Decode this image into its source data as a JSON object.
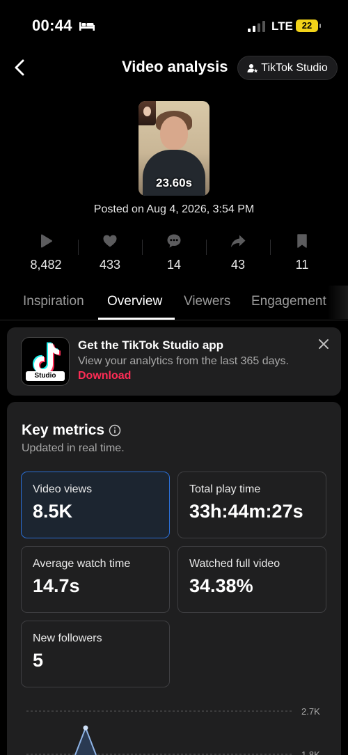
{
  "status_bar": {
    "time": "00:44",
    "network": "LTE",
    "battery": "22"
  },
  "header": {
    "title": "Video analysis",
    "studio_button": "TikTok Studio"
  },
  "video": {
    "duration": "23.60s",
    "posted": "Posted on Aug 4, 2026, 3:54 PM"
  },
  "stats": [
    {
      "icon": "play-icon",
      "value": "8,482"
    },
    {
      "icon": "heart-icon",
      "value": "433"
    },
    {
      "icon": "comment-icon",
      "value": "14"
    },
    {
      "icon": "share-icon",
      "value": "43"
    },
    {
      "icon": "bookmark-icon",
      "value": "11"
    }
  ],
  "tabs": [
    "Inspiration",
    "Overview",
    "Viewers",
    "Engagement"
  ],
  "active_tab": "Overview",
  "promo": {
    "title": "Get the TikTok Studio app",
    "subtitle": "View your analytics from the last 365 days.",
    "link": "Download",
    "icon_label": "Studio"
  },
  "key_metrics": {
    "title": "Key metrics",
    "subtitle": "Updated in real time.",
    "cards": [
      {
        "label": "Video views",
        "value": "8.5K",
        "selected": true
      },
      {
        "label": "Total play time",
        "value": "33h:44m:27s"
      },
      {
        "label": "Average watch time",
        "value": "14.7s"
      },
      {
        "label": "Watched full video",
        "value": "34.38%"
      },
      {
        "label": "New followers",
        "value": "5"
      }
    ]
  },
  "chart_data": {
    "type": "line",
    "y_ticks": [
      "2.7K",
      "1.8K"
    ],
    "peak_value": 2.7
  },
  "colors": {
    "accent": "#fe2c55",
    "selected_border": "#2a6fd6",
    "chart_line": "#8fb4e6"
  }
}
